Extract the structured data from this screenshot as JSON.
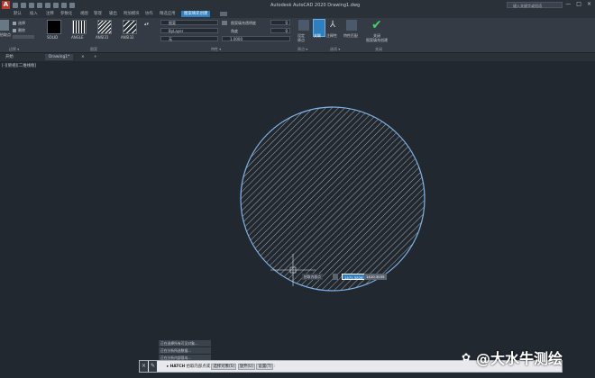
{
  "window": {
    "title": "Autodesk AutoCAD 2020  Drawing1.dwg",
    "search_placeholder": "键入关键字或短语",
    "controls": [
      "—",
      "□",
      "×"
    ]
  },
  "ribbon_tabs": [
    "默认",
    "插入",
    "注释",
    "参数化",
    "视图",
    "管理",
    "输出",
    "附加模块",
    "协作",
    "精选应用",
    "图案填充创建"
  ],
  "active_tab_index": 10,
  "ribbon": {
    "boundary_panel": {
      "pick_label": "拾取点",
      "select_label": "选择",
      "remove_label": "删除",
      "panel_label": "边界 ▾"
    },
    "pattern_panel": {
      "swatches": [
        "SOLID",
        "ANGLE",
        "ANSI31",
        "ANSI32"
      ],
      "panel_label": "图案"
    },
    "properties_panel": {
      "type_value": "图案",
      "color_value": "ByLayer",
      "bg_value": "无",
      "transparency_label": "图案填充透明度",
      "transparency_value": "0",
      "angle_label": "角度",
      "angle_value": "0",
      "scale_value": "1.0000",
      "panel_label": "特性 ▾"
    },
    "origin_panel": {
      "set_origin_label": "设定\n原点",
      "panel_label": "原点 ▾"
    },
    "options_panel": {
      "assoc_label": "关联",
      "annot_label": "注释性",
      "match_label": "特性匹配",
      "panel_label": "选项 ▾"
    },
    "close_panel": {
      "close_label": "关闭\n图案填充创建",
      "panel_label": "关闭"
    }
  },
  "doc_tabs": {
    "start": "开始",
    "drawing": "Drawing1*",
    "close": "×",
    "add": "+"
  },
  "viewport_label": "[-][俯视][二维线框]",
  "dynamic_input": {
    "prompt": "拾取内部点",
    "value1": "1471.5826",
    "value2": "1410.3035"
  },
  "command_history": [
    "正在选择所有可见对象...",
    "正在分析所选数据...",
    "正在分析内部孤岛..."
  ],
  "command_line": {
    "command": "HATCH",
    "prompt": "拾取内部点或",
    "options": [
      "选择对象(S)",
      "放弃(U)",
      "设置(T)"
    ],
    "suffix": ":"
  },
  "watermark": "@大水牛测绘",
  "colors": {
    "background": "#212830",
    "ribbon": "#343b44",
    "accent": "#2f7fbf",
    "circle": "#7fb2e6",
    "hatch": "#c9ced4"
  }
}
